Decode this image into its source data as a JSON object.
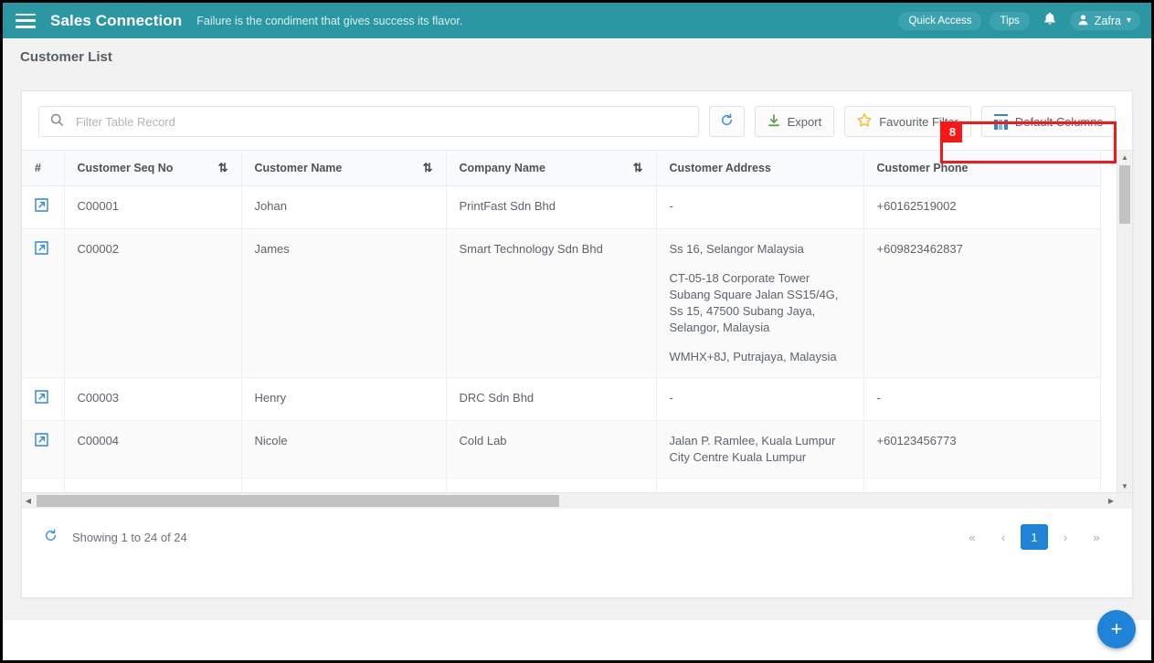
{
  "topbar": {
    "menu_icon": "hamburger-icon",
    "brand": "Sales Connection",
    "tagline": "Failure is the condiment that gives success its flavor.",
    "quick_access": "Quick Access",
    "tips": "Tips",
    "bell_icon": "\u0007",
    "user_name": "Zafra",
    "user_icon": "👤",
    "caret_icon": "▾"
  },
  "page": {
    "title": "Customer List"
  },
  "toolbar": {
    "search_placeholder": "Filter Table Record",
    "search_value": "",
    "search_icon": "⚲",
    "refresh_icon": "↻",
    "export_label": "Export",
    "export_icon": "⬇",
    "favourite_label": "Favourite Filter",
    "favourite_icon": "★",
    "default_columns_label": "Default Columns"
  },
  "annotation": {
    "number": "8",
    "target": "default-columns-button"
  },
  "table": {
    "columns": [
      {
        "label": "#",
        "sortable": false
      },
      {
        "label": "Customer Seq No",
        "sortable": true
      },
      {
        "label": "Customer Name",
        "sortable": true
      },
      {
        "label": "Company Name",
        "sortable": true
      },
      {
        "label": "Customer Address",
        "sortable": false
      },
      {
        "label": "Customer Phone",
        "sortable": false
      }
    ],
    "sort_icon": "⇅",
    "row_action_icon": "↗",
    "rows": [
      {
        "seq": "C00001",
        "name": "Johan",
        "company": "PrintFast Sdn Bhd",
        "address": [
          "-"
        ],
        "phone": "+60162519002"
      },
      {
        "seq": "C00002",
        "name": "James",
        "company": "Smart Technology Sdn Bhd",
        "address": [
          "Ss 16, Selangor Malaysia",
          "CT-05-18 Corporate Tower Subang Square Jalan SS15/4G, Ss 15, 47500 Subang Jaya, Selangor, Malaysia",
          "WMHX+8J, Putrajaya, Malaysia"
        ],
        "phone": "+609823462837"
      },
      {
        "seq": "C00003",
        "name": "Henry",
        "company": "DRC Sdn Bhd",
        "address": [
          "-"
        ],
        "phone": "-"
      },
      {
        "seq": "C00004",
        "name": "Nicole",
        "company": "Cold Lab",
        "address": [
          "Jalan P. Ramlee, Kuala Lumpur City Centre Kuala Lumpur"
        ],
        "phone": "+60123456773"
      }
    ]
  },
  "scrollbars": {
    "v_up_icon": "▲",
    "v_down_icon": "▼",
    "h_left_icon": "◀",
    "h_right_icon": "▶"
  },
  "footer": {
    "refresh_icon": "↻",
    "showing": "Showing 1 to 24 of 24",
    "pager": {
      "first": "«",
      "prev": "‹",
      "pages": [
        "1"
      ],
      "active_page": "1",
      "next": "›",
      "last": "»"
    }
  },
  "fab": {
    "icon": "+",
    "name": "add-customer-button"
  },
  "colors": {
    "header_teal": "#2b97a3",
    "accent_blue": "#1f83d8",
    "annotation_red": "#f91616",
    "export_green": "#59a14f",
    "star_yellow": "#f3c233"
  }
}
